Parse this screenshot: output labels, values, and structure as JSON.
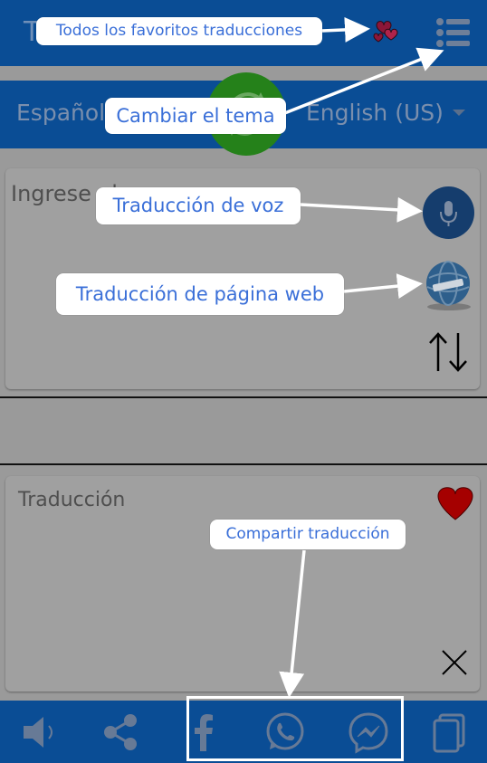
{
  "header": {
    "title": "T",
    "favorites_icon": "hearts-icon",
    "menu_icon": "list-menu-icon"
  },
  "languages": {
    "source": "Español(",
    "target": "English (US)",
    "dropdown_icon": "caret-down-icon",
    "theme_icon": "refresh-icon"
  },
  "input": {
    "placeholder": "Ingrese el",
    "mic_icon": "microphone-icon",
    "web_icon": "globe-icon",
    "swap_icon": "swap-arrows-icon"
  },
  "output": {
    "placeholder": "Traducción",
    "favorite_icon": "heart-icon",
    "clear_icon": "close-icon"
  },
  "bottom_bar": {
    "icons": [
      "speaker-icon",
      "share-icon",
      "facebook-icon",
      "whatsapp-icon",
      "messenger-icon",
      "copy-icon"
    ]
  },
  "callouts": {
    "favorites": "Todos los favoritos traducciones",
    "theme": "Cambiar el tema",
    "voice": "Traducción de voz",
    "web": "Traducción de página web",
    "share": "Compartir traducción"
  },
  "colors": {
    "primary": "#0a4d95",
    "overlay": "#9a9a9a",
    "callout_text": "#3a6fd8",
    "theme_button": "#25811a",
    "heart": "#a50000"
  }
}
